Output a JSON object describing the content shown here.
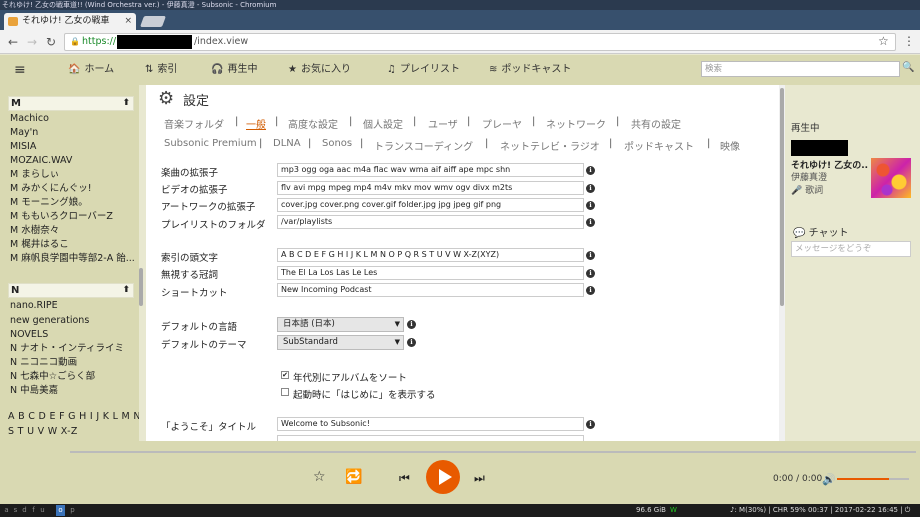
{
  "window": {
    "title": "それゆけ! 乙女の戦車道!! (Wind Orchestra ver.) - 伊藤真澄 - Subsonic - Chromium"
  },
  "browser": {
    "tab_title": "それゆけ! 乙女の戦車",
    "tab_close": "×",
    "url_scheme": "https://",
    "url_path": "/index.view",
    "back": "←",
    "forward": "→",
    "reload": "↻",
    "lock": "🔒",
    "bookmark_star": "☆",
    "menu": "⋮"
  },
  "nav": {
    "menu_icon": "≡",
    "items": [
      {
        "label": "ホーム",
        "icon": "🏠"
      },
      {
        "label": "索引",
        "icon": "⇅"
      },
      {
        "label": "再生中",
        "icon": "🎧"
      },
      {
        "label": "お気に入り",
        "icon": "★"
      },
      {
        "label": "プレイリスト",
        "icon": "♫"
      },
      {
        "label": "ポッドキャスト",
        "icon": "≋"
      }
    ],
    "search_placeholder": "検索",
    "search_icon": "🔍"
  },
  "sidebar": {
    "groups": [
      {
        "letter": "M",
        "artists": [
          "Machico",
          "May'n",
          "MISIA",
          "MOZAIC.WAV",
          "M まらしぃ",
          "M みかくにんぐッ!",
          "M モーニング娘。",
          "M ももいろクローバーZ",
          "M 水樹奈々",
          "M 梶井はるこ",
          "M 麻帆良学園中等部2-A 飴..."
        ]
      },
      {
        "letter": "N",
        "artists": [
          "nano.RIPE",
          "new generations",
          "NOVELS",
          "N ナオト・インティライミ",
          "N ニコニコ動画",
          "N 七森中☆ごらく部",
          "N 中島美嘉"
        ]
      }
    ],
    "up_arrow": "⬆",
    "alphabet_line1": "A B C D E F G H I J K L M N O P Q",
    "alphabet_line2": "S T U V W X-Z"
  },
  "settings": {
    "title": "設定",
    "gear_icon": "⚙",
    "tabs_row1": [
      "音楽フォルダ",
      "一般",
      "高度な設定",
      "個人設定",
      "ユーザ",
      "プレーヤ",
      "ネットワーク",
      "共有の設定"
    ],
    "tabs_row2": [
      "Subsonic Premium",
      "DLNA",
      "Sonos",
      "トランスコーディング",
      "ネットテレビ・ラジオ",
      "ポッドキャスト",
      "映像"
    ],
    "active_tab": "一般",
    "separator": "|",
    "fields": [
      {
        "label": "楽曲の拡張子",
        "value": "mp3 ogg oga aac m4a flac wav wma aif aiff ape mpc shn"
      },
      {
        "label": "ビデオの拡張子",
        "value": "flv avi mpg mpeg mp4 m4v mkv mov wmv ogv divx m2ts"
      },
      {
        "label": "アートワークの拡張子",
        "value": "cover.jpg cover.png cover.gif folder.jpg jpg jpeg gif png"
      },
      {
        "label": "プレイリストのフォルダ",
        "value": "/var/playlists"
      },
      {
        "label": "索引の頭文字",
        "value": "A B C D E F G H I J K L M N O P Q R S T U V W X-Z(XYZ)"
      },
      {
        "label": "無視する冠詞",
        "value": "The El La Los Las Le Les"
      },
      {
        "label": "ショートカット",
        "value": "New Incoming Podcast"
      }
    ],
    "language_label": "デフォルトの言語",
    "language_value": "日本語 (日本)",
    "theme_label": "デフォルトのテーマ",
    "theme_value": "SubStandard",
    "checkbox1_label": "年代別にアルバムをソート",
    "checkbox1_mark": "✔",
    "checkbox2_label": "起動時に「はじめに」を表示する",
    "welcome_label": "「ようこそ」タイトル",
    "welcome_value": "Welcome to Subsonic!",
    "info_glyph": "i",
    "select_arrow": "▼"
  },
  "now_playing": {
    "title": "再生中",
    "song": "それゆけ! 乙女の...",
    "artist": "伊藤真澄",
    "lyrics": "🎤 歌詞"
  },
  "chat": {
    "title": "💬 チャット",
    "placeholder": "メッセージをどうぞ"
  },
  "player": {
    "star": "☆",
    "repeat": "🔁",
    "prev": "⏮",
    "next": "⏭",
    "time": "0:00 / 0:00",
    "volume_icon": "🔊",
    "volume_level": 0.72
  },
  "statusbar": {
    "workspaces": [
      "a",
      "s",
      "d",
      "f",
      "u",
      "o",
      "p"
    ],
    "active_workspace": "o",
    "disk": "96.6 GiB",
    "wifi": "W",
    "right": "♪: M(30%) | CHR 59% 00:37 | 2017-02-22 16:45 | ⏻"
  }
}
